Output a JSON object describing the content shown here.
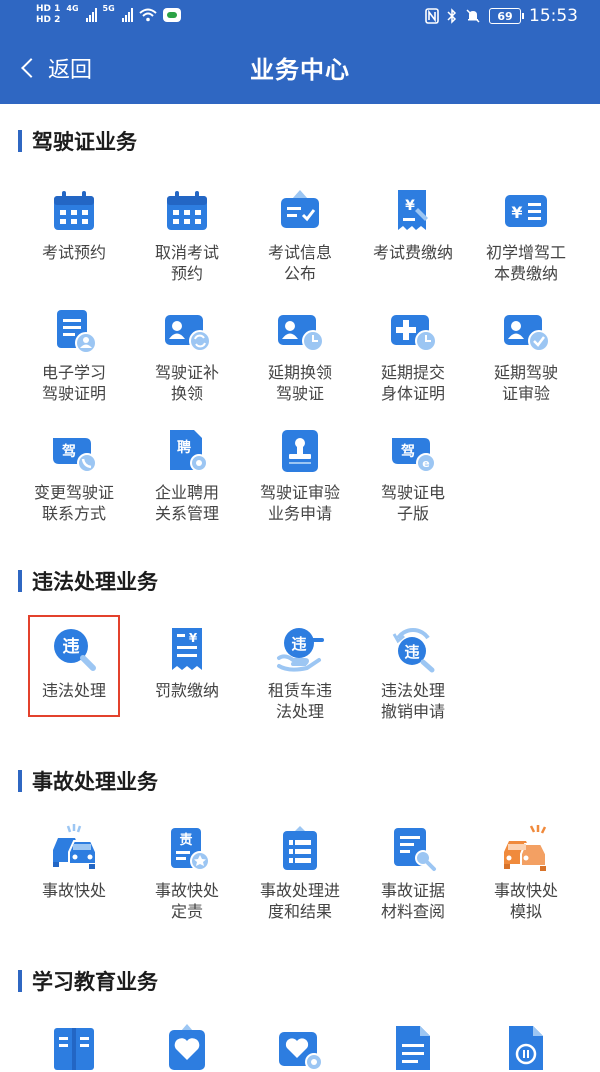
{
  "status_bar": {
    "hd1": "HD 1",
    "hd2": "HD 2",
    "net1": "4G",
    "net2": "5G",
    "battery": "69",
    "time": "15:53"
  },
  "nav": {
    "back_label": "返回",
    "title": "业务中心"
  },
  "sections": {
    "license": {
      "title": "驾驶证业务",
      "items": [
        [
          "考试预约"
        ],
        [
          "取消考试",
          "预约"
        ],
        [
          "考试信息",
          "公布"
        ],
        [
          "考试费缴纳"
        ],
        [
          "初学增驾工",
          "本费缴纳"
        ],
        [
          "电子学习",
          "驾驶证明"
        ],
        [
          "驾驶证补",
          "换领"
        ],
        [
          "延期换领",
          "驾驶证"
        ],
        [
          "延期提交",
          "身体证明"
        ],
        [
          "延期驾驶",
          "证审验"
        ],
        [
          "变更驾驶证",
          "联系方式"
        ],
        [
          "企业聘用",
          "关系管理"
        ],
        [
          "驾驶证审验",
          "业务申请"
        ],
        [
          "驾驶证电",
          "子版"
        ]
      ]
    },
    "violation": {
      "title": "违法处理业务",
      "items": [
        [
          "违法处理"
        ],
        [
          "罚款缴纳"
        ],
        [
          "租赁车违",
          "法处理"
        ],
        [
          "违法处理",
          "撤销申请"
        ]
      ]
    },
    "accident": {
      "title": "事故处理业务",
      "items": [
        [
          "事故快处"
        ],
        [
          "事故快处",
          "定责"
        ],
        [
          "事故处理进",
          "度和结果"
        ],
        [
          "事故证据",
          "材料查阅"
        ],
        [
          "事故快处",
          "模拟"
        ]
      ]
    },
    "education": {
      "title": "学习教育业务"
    }
  },
  "icon_glyphs": {
    "fee": "¥",
    "license_char": "驾",
    "hire_char": "聘",
    "violation_char": "违",
    "responsibility_char": "责"
  },
  "colors": {
    "header": "#2f67c2",
    "icon_primary": "#2d7de0",
    "icon_light": "#9cc6f3",
    "highlight": "#e3412c",
    "accent_orange": "#f08a3c"
  }
}
